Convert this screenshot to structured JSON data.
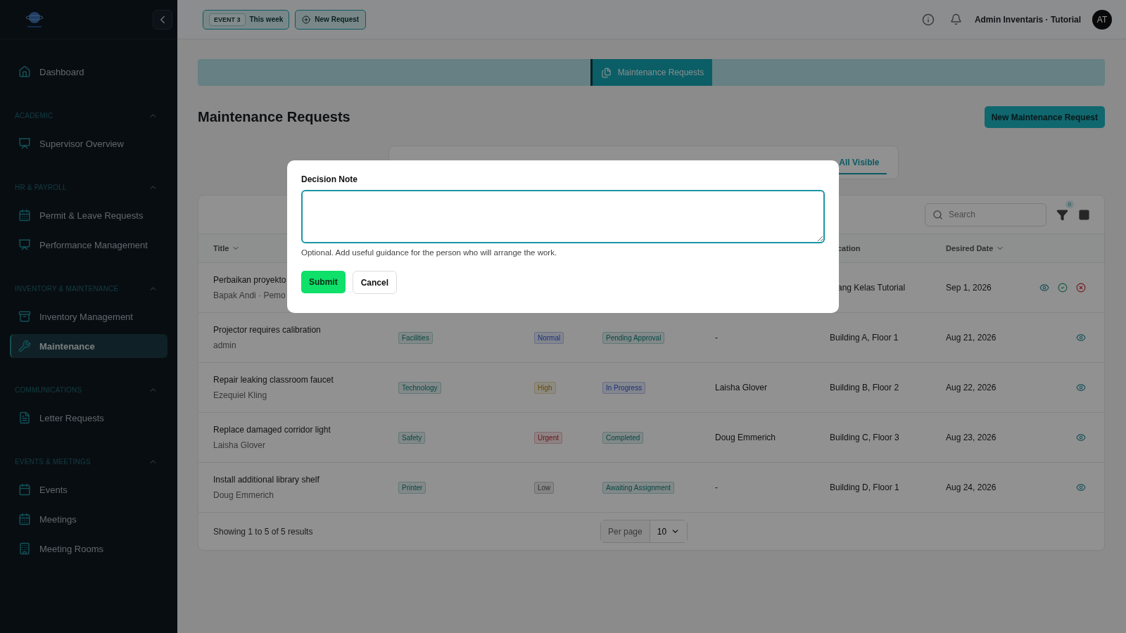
{
  "sidebar": {
    "top_items": [
      {
        "label": "Dashboard",
        "selected": false
      }
    ],
    "sections": [
      {
        "title": "ACADEMIC",
        "expanded": true,
        "items": [
          {
            "label": "Supervisor Overview",
            "selected": false
          }
        ]
      },
      {
        "title": "HR & PAYROLL",
        "expanded": true,
        "items": [
          {
            "label": "Permit & Leave Requests",
            "selected": false
          },
          {
            "label": "Performance Management",
            "selected": false
          }
        ]
      },
      {
        "title": "INVENTORY & MAINTENANCE",
        "expanded": true,
        "items": [
          {
            "label": "Inventory Management",
            "selected": false
          },
          {
            "label": "Maintenance",
            "selected": true
          }
        ]
      },
      {
        "title": "COMMUNICATIONS",
        "expanded": true,
        "items": [
          {
            "label": "Letter Requests",
            "selected": false
          }
        ]
      },
      {
        "title": "EVENTS & MEETINGS",
        "expanded": true,
        "items": [
          {
            "label": "Events",
            "selected": false
          },
          {
            "label": "Meetings",
            "selected": false
          },
          {
            "label": "Meeting Rooms",
            "selected": false
          }
        ]
      }
    ]
  },
  "topbar": {
    "event_badge": "EVENT 3",
    "event_period": "This week",
    "new_request": "New Request",
    "user_name": "Admin Inventaris · Tutorial",
    "avatar": "AT"
  },
  "banner": {
    "label": "Maintenance Requests"
  },
  "page": {
    "title": "Maintenance Requests",
    "primary_button": "New Maintenance Request"
  },
  "filter_tabs": [
    {
      "label": "All Visible",
      "selected": true
    }
  ],
  "table": {
    "search_placeholder": "Search",
    "filter_count": "0",
    "columns": [
      {
        "label": "Title"
      },
      {
        "label": "cation"
      },
      {
        "label": "Desired Date"
      }
    ],
    "rows": [
      {
        "title": "Perbaikan proyekto",
        "requester": "Bapak Andi · Pemo",
        "location": "ang Kelas Tutorial",
        "date": "Sep 1, 2026",
        "actions": [
          {
            "kind": "view"
          },
          {
            "kind": "approve"
          },
          {
            "kind": "reject"
          }
        ]
      },
      {
        "title": "Projector requires calibration",
        "requester": "admin",
        "category": "Facilities",
        "priority": {
          "label": "Normal",
          "kind": "normal"
        },
        "status": {
          "label": "Pending Approval",
          "kind": "pending"
        },
        "assignee": "-",
        "location": "Building A, Floor 1",
        "date": "Aug 21, 2026",
        "actions": [
          {
            "kind": "view"
          }
        ]
      },
      {
        "title": "Repair leaking classroom faucet",
        "requester": "Ezequiel Kling",
        "category": "Technology",
        "priority": {
          "label": "High",
          "kind": "high"
        },
        "status": {
          "label": "In Progress",
          "kind": "progress"
        },
        "assignee": "Laisha Glover",
        "location": "Building B, Floor 2",
        "date": "Aug 22, 2026",
        "actions": [
          {
            "kind": "view"
          }
        ]
      },
      {
        "title": "Replace damaged corridor light",
        "requester": "Laisha Glover",
        "category": "Safety",
        "priority": {
          "label": "Urgent",
          "kind": "urgent"
        },
        "status": {
          "label": "Completed",
          "kind": "completed"
        },
        "assignee": "Doug Emmerich",
        "location": "Building C, Floor 3",
        "date": "Aug 23, 2026",
        "actions": [
          {
            "kind": "view"
          }
        ]
      },
      {
        "title": "Install additional library shelf",
        "requester": "Doug Emmerich",
        "category": "Printer",
        "priority": {
          "label": "Low",
          "kind": "low"
        },
        "status": {
          "label": "Awaiting Assignment",
          "kind": "awaiting"
        },
        "assignee": "-",
        "location": "Building D, Floor 1",
        "date": "Aug 24, 2026",
        "actions": [
          {
            "kind": "view"
          }
        ]
      }
    ],
    "footer": {
      "summary": "Showing 1 to 5 of 5 results",
      "per_page_label": "Per page",
      "per_page_value": "10"
    }
  },
  "modal": {
    "label": "Decision Note",
    "hint": "Optional. Add useful guidance for the person who will arrange the work.",
    "submit": "Submit",
    "cancel": "Cancel"
  }
}
